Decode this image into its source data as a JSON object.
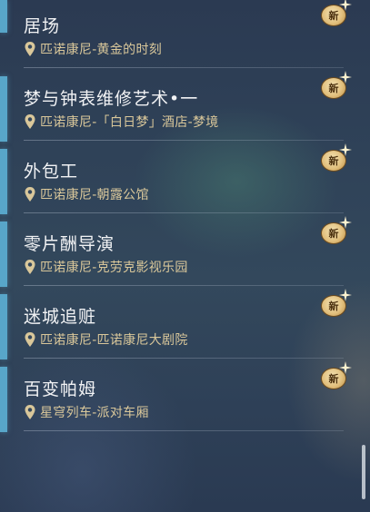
{
  "badge_label": "新",
  "colors": {
    "accent": "#58a6c9",
    "location_text": "#d9c79a",
    "badge_gold": "#e2c07e"
  },
  "items": [
    {
      "title": "居场",
      "location": "匹诺康尼-黄金的时刻"
    },
    {
      "title": "梦与钟表维修艺术•一",
      "location": "匹诺康尼-「白日梦」酒店-梦境"
    },
    {
      "title": "外包工",
      "location": "匹诺康尼-朝露公馆"
    },
    {
      "title": "零片酬导演",
      "location": "匹诺康尼-克劳克影视乐园"
    },
    {
      "title": "迷城追赃",
      "location": "匹诺康尼-匹诺康尼大剧院"
    },
    {
      "title": "百变帕姆",
      "location": "星穹列车-派对车厢"
    }
  ]
}
